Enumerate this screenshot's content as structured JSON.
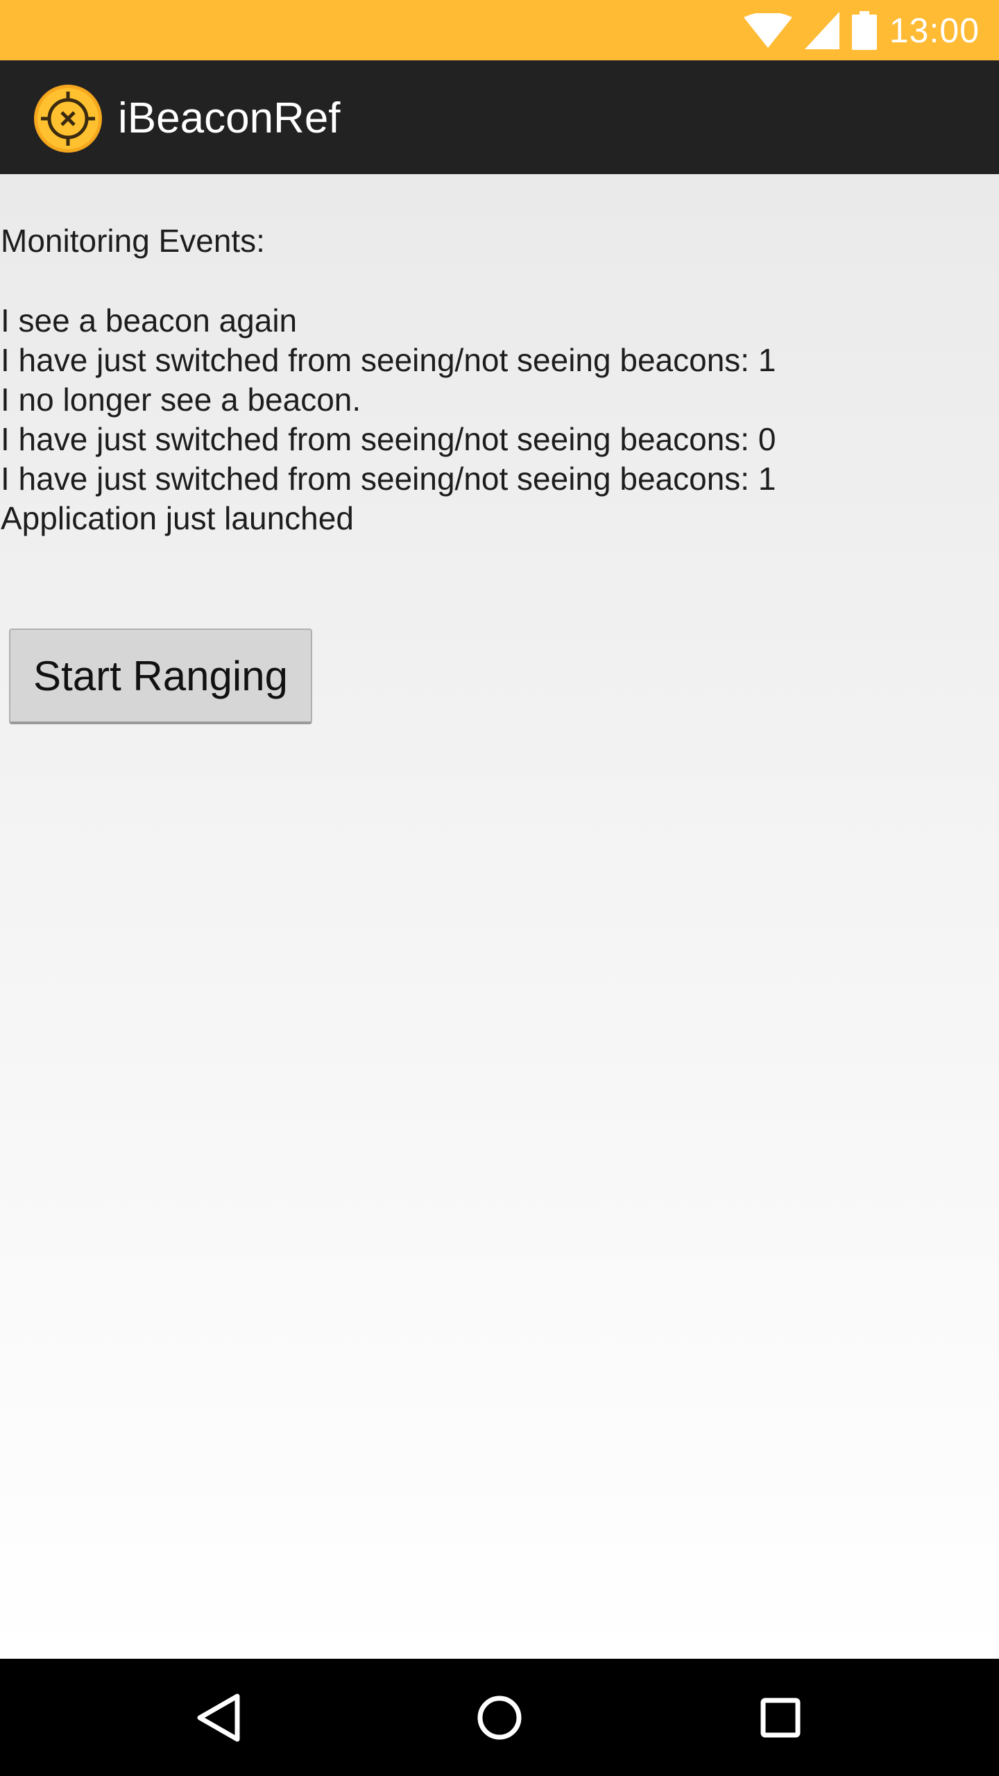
{
  "status_bar": {
    "time": "13:00",
    "icons": [
      "wifi-icon",
      "cell-signal-icon",
      "battery-icon"
    ],
    "color": "#ffbb33"
  },
  "action_bar": {
    "app_title": "iBeaconRef",
    "app_icon": "target-icon",
    "color": "#222222"
  },
  "main": {
    "events_label": "Monitoring Events:",
    "events": [
      "I see a beacon again",
      "I have just switched from seeing/not seeing beacons: 1",
      "I no longer see a beacon.",
      "I have just switched from seeing/not seeing beacons: 0",
      "I have just switched from seeing/not seeing beacons: 1",
      "Application just launched"
    ],
    "start_button_label": "Start Ranging"
  },
  "nav_bar": {
    "buttons": [
      "back-icon",
      "home-icon",
      "recents-icon"
    ]
  }
}
